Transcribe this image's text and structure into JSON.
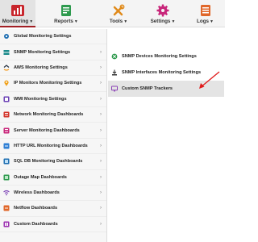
{
  "nav": {
    "items": [
      {
        "label": "Monitoring",
        "icon": "bar-chart-icon"
      },
      {
        "label": "Reports",
        "icon": "report-icon"
      },
      {
        "label": "Tools",
        "icon": "tools-icon"
      },
      {
        "label": "Settings",
        "icon": "gear-icon"
      },
      {
        "label": "Logs",
        "icon": "logs-icon"
      }
    ],
    "accent": "#a21f24"
  },
  "menu": {
    "items": [
      {
        "label": "Global Monitoring Settings",
        "icon": "gear-icon"
      },
      {
        "label": "SNMP Monitoring Settings",
        "icon": "snmp-icon"
      },
      {
        "label": "AWS Monitoring Settings",
        "icon": "aws-icon"
      },
      {
        "label": "IP Monitors Monitoring Settings",
        "icon": "ip-pin-icon"
      },
      {
        "label": "WMI Monitoring Settings",
        "icon": "wmi-icon"
      },
      {
        "label": "Network Monitoring Dashboards",
        "icon": "network-icon"
      },
      {
        "label": "Server Monitoring Dashboards",
        "icon": "server-icon"
      },
      {
        "label": "HTTP URL Monitoring Dashboards",
        "icon": "http-icon"
      },
      {
        "label": "SQL DB Monitoring Dashboards",
        "icon": "database-icon"
      },
      {
        "label": "Outage Map Dashboards",
        "icon": "map-icon"
      },
      {
        "label": "Wireless Dashboards",
        "icon": "wifi-icon"
      },
      {
        "label": "Netflow Dashboards",
        "icon": "netflow-icon"
      },
      {
        "label": "Custom Dashboards",
        "icon": "custom-dashboard-icon"
      }
    ]
  },
  "submenu": {
    "items": [
      {
        "label": "SNMP Devices Monitoring Settings",
        "icon": "snmp-devices-icon"
      },
      {
        "label": "SNMP Interfaces Monitoring Settings",
        "icon": "snmp-interfaces-icon"
      },
      {
        "label": "Custom SNMP Trackers",
        "icon": "monitor-icon"
      }
    ]
  }
}
